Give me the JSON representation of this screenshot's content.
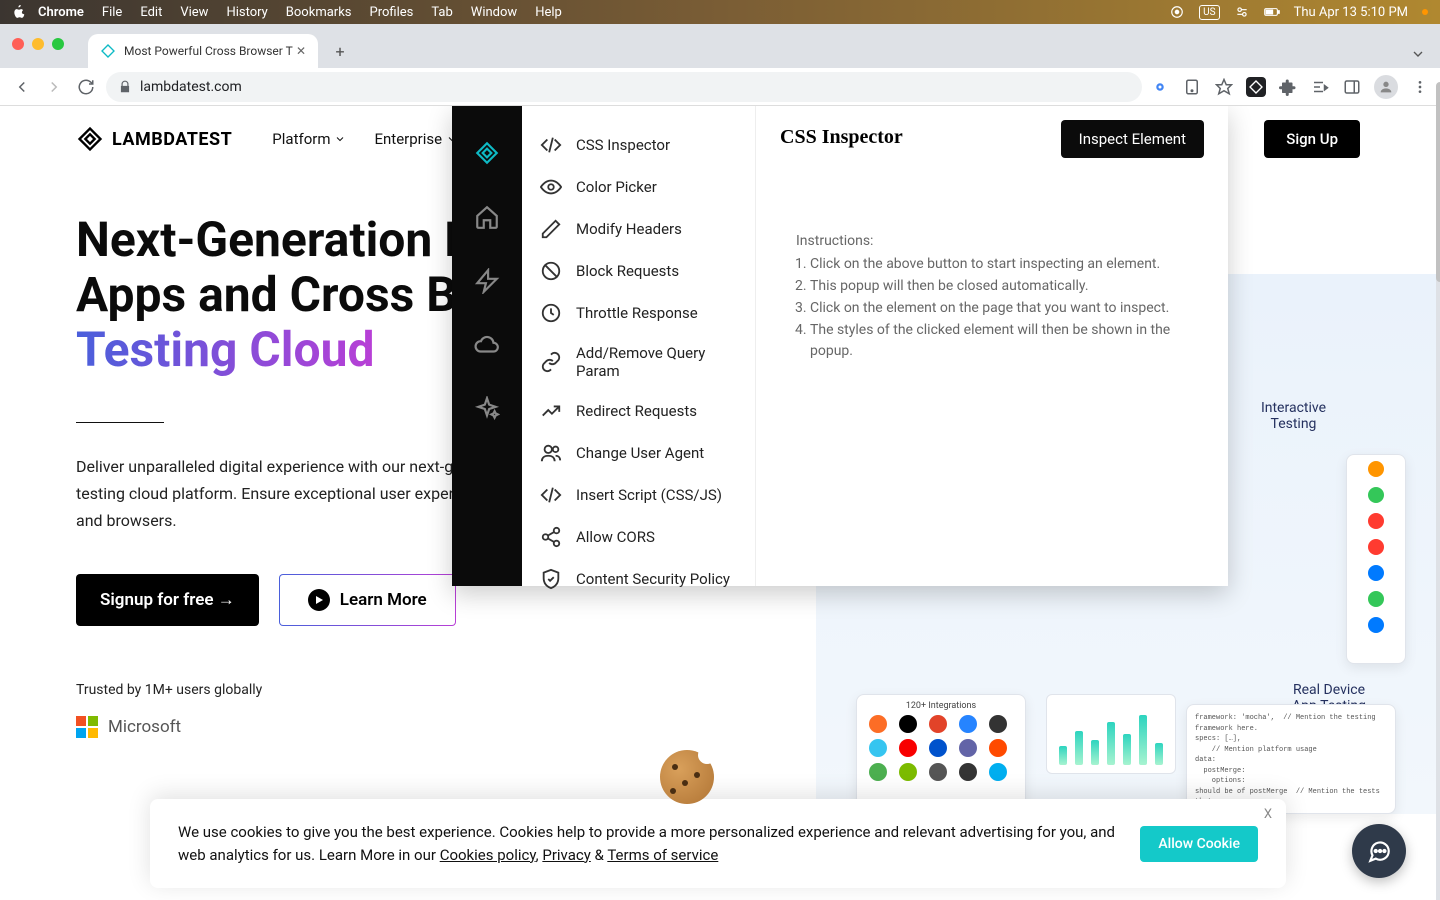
{
  "menubar": {
    "app": "Chrome",
    "items": [
      "File",
      "Edit",
      "View",
      "History",
      "Bookmarks",
      "Profiles",
      "Tab",
      "Window",
      "Help"
    ],
    "input_source": "US",
    "clock": "Thu Apr 13  5:10 PM"
  },
  "browser": {
    "tab_title": "Most Powerful Cross Browser T",
    "url": "lambdatest.com"
  },
  "site": {
    "logo_text": "LAMBDATEST",
    "nav": [
      "Platform",
      "Enterprise"
    ],
    "signup": "Sign Up"
  },
  "hero": {
    "title_line1": "Next-Generation Mobile",
    "title_line2": "Apps and Cross Browser",
    "title_grad": "Testing Cloud",
    "body": "Deliver unparalleled digital experience with our next-generation AI-powered testing cloud platform. Ensure exceptional user experience across all devices and browsers.",
    "primary_cta": "Signup for free →",
    "secondary_cta": "Learn More",
    "trusted": "Trusted by 1M+ users globally",
    "ms_text": "Microsoft"
  },
  "right_graphics": {
    "label_a_line1": "Interactive",
    "label_a_line2": "Testing",
    "label_b_line1": "Real Device",
    "label_b_line2": "App Testing",
    "integrations_title": "120+ Integrations"
  },
  "extension": {
    "rail": [
      "logo",
      "home",
      "bolt",
      "cloud",
      "sparkle"
    ],
    "tools": [
      "CSS Inspector",
      "Color Picker",
      "Modify Headers",
      "Block Requests",
      "Throttle Response",
      "Add/Remove Query Param",
      "Redirect Requests",
      "Change User Agent",
      "Insert Script (CSS/JS)",
      "Allow CORS",
      "Content Security Policy"
    ],
    "title": "CSS Inspector",
    "button": "Inspect Element",
    "instructions_heading": "Instructions:",
    "instructions": [
      "Click on the above button to start inspecting an element.",
      "This popup will then be closed automatically.",
      "Click on the element on the page that you want to inspect.",
      "The styles of the clicked element will then be shown in the popup."
    ]
  },
  "cookie": {
    "text_1": "We use cookies to give you the best experience. Cookies help to provide a more personalized experience and relevant advertising for you, and web analytics for us. Learn More in our ",
    "link_1": "Cookies policy",
    "sep_1": ", ",
    "link_2": "Privacy",
    "sep_2": " & ",
    "link_3": "Terms of service",
    "allow": "Allow Cookie",
    "close": "X"
  },
  "colors": {
    "accent": "#0ebac5",
    "black": "#0b0b0b",
    "cookie_btn": "#14c9c9"
  }
}
